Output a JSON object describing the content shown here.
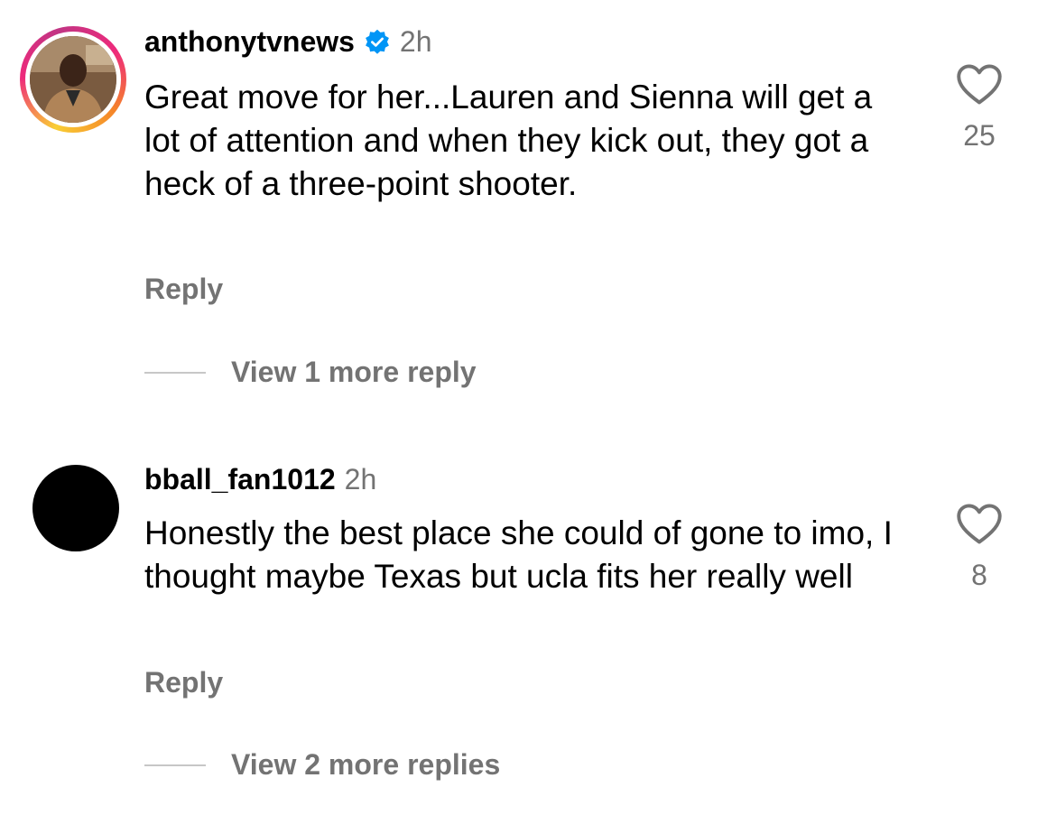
{
  "comments": [
    {
      "username": "anthonytvnews",
      "verified": true,
      "time": "2h",
      "text": "Great move for her...Lauren and Sienna will get a lot of attention and when they kick out, they got a heck of a three-point shooter.",
      "likes": "25",
      "reply_label": "Reply",
      "view_more": "View 1 more reply",
      "avatar": "profile-photo"
    },
    {
      "username": "bball_fan1012",
      "verified": false,
      "time": "2h",
      "text": "Honestly the best place she could of gone to imo, I thought maybe Texas but ucla fits her really well",
      "likes": "8",
      "reply_label": "Reply",
      "view_more": "View 2 more replies",
      "avatar": "blank-black"
    }
  ],
  "icons": {
    "like": "heart-outline-icon",
    "verified": "verified-badge-icon"
  },
  "colors": {
    "verified_blue": "#0095f6",
    "secondary_text": "#737373",
    "divider": "#c7c7c7"
  }
}
